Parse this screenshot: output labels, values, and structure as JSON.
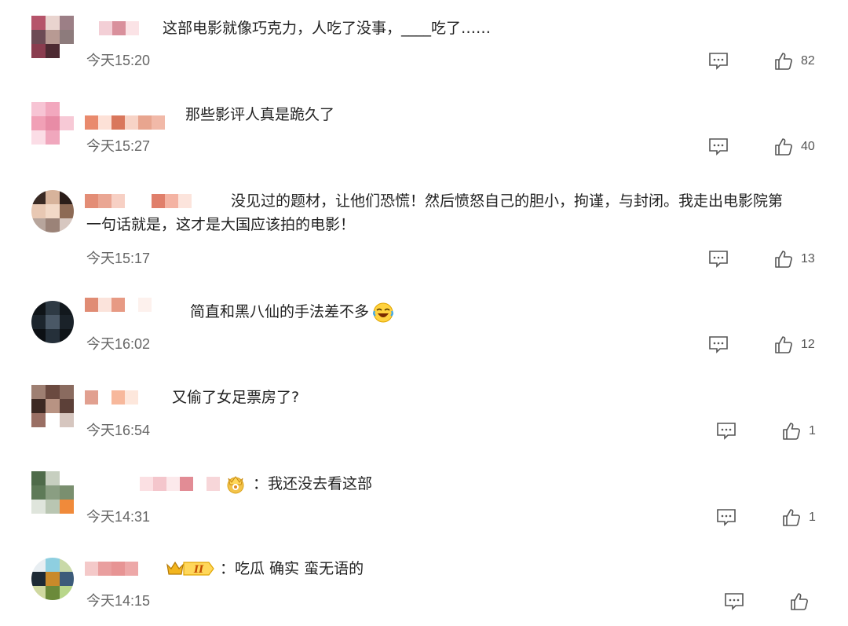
{
  "comments": [
    {
      "text": "这部电影就像巧克力，人吃了没事，____吃了……",
      "time": "今天15:20",
      "likes": "82"
    },
    {
      "text": "那些影评人真是跪久了",
      "time": "今天15:27",
      "likes": "40"
    },
    {
      "text": "没见过的题材，让他们恐慌！然后愤怒自己的胆小，拘谨，与封闭。我走出电影院第一句话就是，这才是大国应该拍的电影！",
      "line1": "没见过的题材，让他们恐慌！然后愤怒自己的胆小，拘谨，与封闭。我走出电影院第",
      "line2": "一句话就是，这才是大国应该拍的电影！",
      "time": "今天15:17",
      "likes": "13"
    },
    {
      "text": "简直和黑八仙的手法差不多",
      "time": "今天16:02",
      "likes": "12"
    },
    {
      "text": "又偷了女足票房了?",
      "time": "今天16:54",
      "likes": "1"
    },
    {
      "text": "：我还没去看这部",
      "time": "今天14:31",
      "likes": "1"
    },
    {
      "text": "：吃瓜 确实 蛮无语的",
      "time": "今天14:15",
      "likes": ""
    }
  ],
  "icons": {
    "reply": "comment-bubble-icon",
    "like": "thumbs-up-icon",
    "emoji": "laughing-crying-emoji",
    "badge": "crown-badge-icon"
  },
  "colors": {
    "text": "#222222",
    "time": "#666666",
    "icon": "#555555",
    "badge_gold": "#e0a500"
  }
}
